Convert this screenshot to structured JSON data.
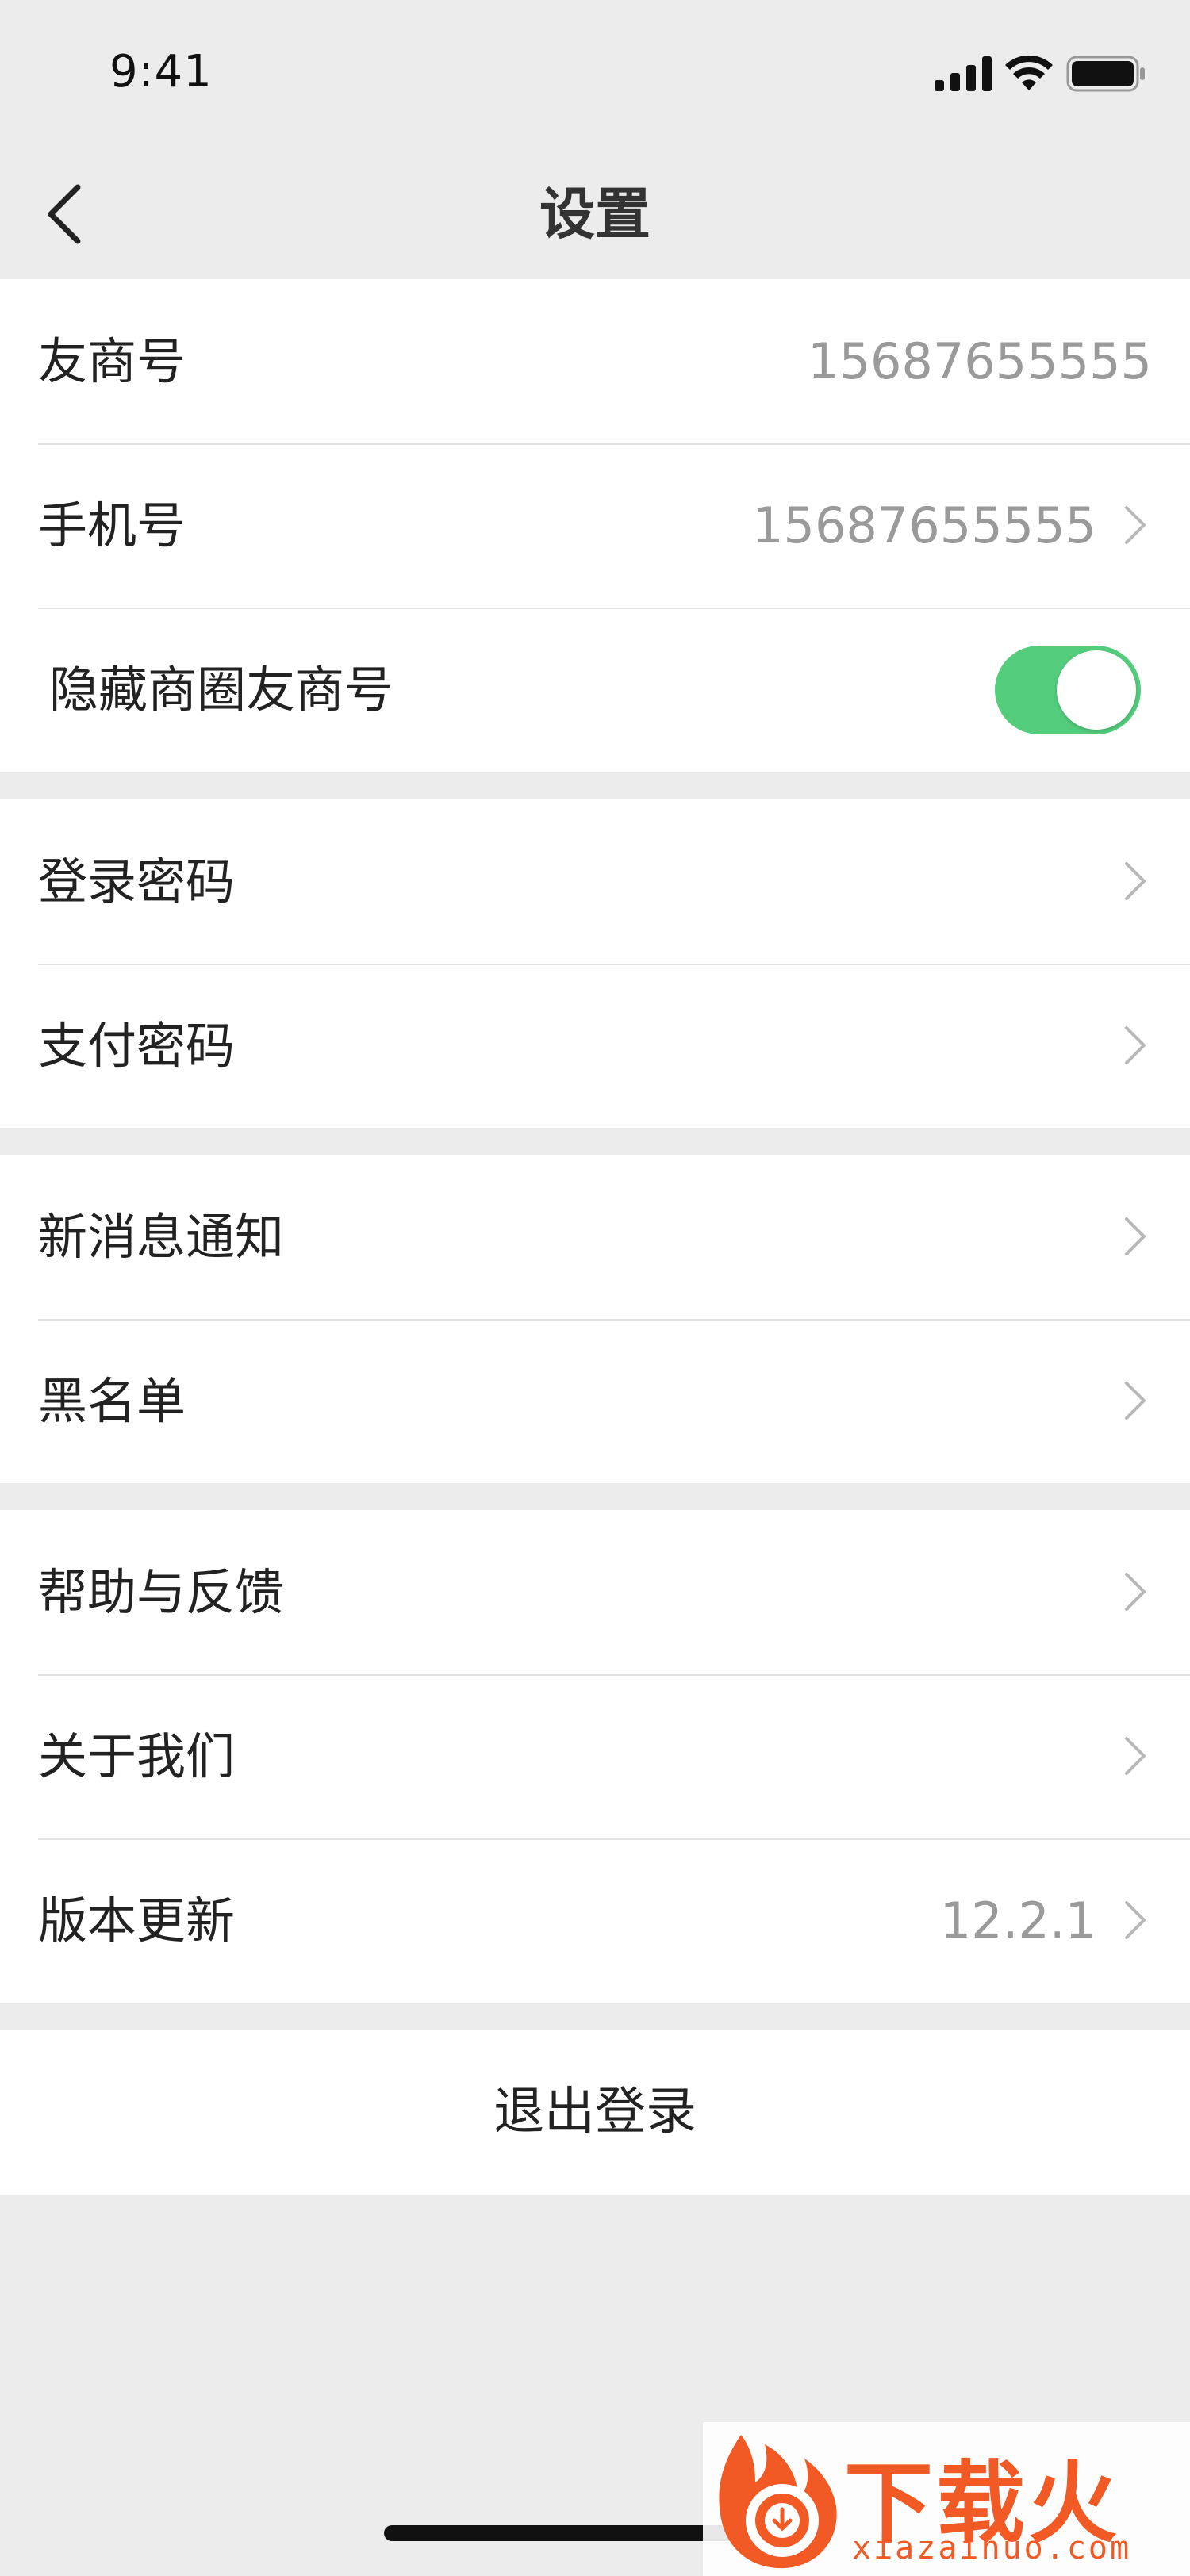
{
  "status_bar": {
    "time": "9:41",
    "icons": [
      "signal-icon",
      "wifi-icon",
      "battery-icon"
    ]
  },
  "nav": {
    "title": "设置",
    "back_icon": "chevron-left-icon"
  },
  "colors": {
    "background": "#ececec",
    "toggle_on": "#53cc7c",
    "value_text": "#9a9a9a",
    "watermark": "#f15a24"
  },
  "account": {
    "merchant_id_label": "友商号",
    "merchant_id_value": "15687655555",
    "phone_label": "手机号",
    "phone_value": "15687655555",
    "hide_id_label": "隐藏商圈友商号",
    "hide_id_enabled": true
  },
  "security": {
    "login_password_label": "登录密码",
    "pay_password_label": "支付密码"
  },
  "notifications": {
    "new_message_label": "新消息通知",
    "blacklist_label": "黑名单"
  },
  "about": {
    "help_label": "帮助与反馈",
    "about_us_label": "关于我们",
    "version_label": "版本更新",
    "version_value": "12.2.1"
  },
  "logout": {
    "label": "退出登录"
  },
  "watermark": {
    "title": "下载火",
    "subtitle": "xiazaihuo.com"
  }
}
